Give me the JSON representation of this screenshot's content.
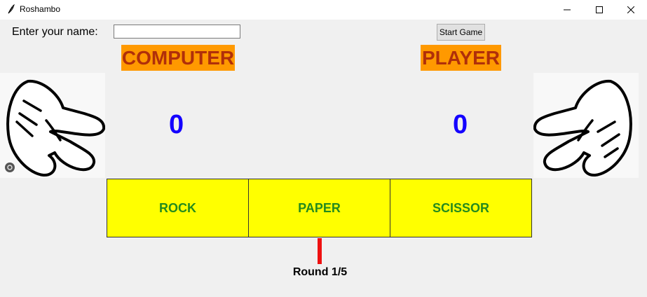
{
  "window": {
    "title": "Roshambo"
  },
  "form": {
    "name_label": "Enter your name:",
    "name_value": "",
    "name_placeholder": "",
    "start_label": "Start Game"
  },
  "computer": {
    "label": "COMPUTER",
    "score": "0",
    "hand_icon": "scissors-hand-icon"
  },
  "player": {
    "label": "PLAYER",
    "score": "0",
    "hand_icon": "scissors-hand-icon"
  },
  "choices": {
    "rock": "ROCK",
    "paper": "PAPER",
    "scissor": "SCISSOR"
  },
  "round": {
    "text": "Round 1/5",
    "current": 1,
    "total": 5
  },
  "colors": {
    "header_bg": "#ff9900",
    "header_text": "#b02f0a",
    "score": "#1400ff",
    "button_bg": "#ffff00",
    "button_text": "#258b1d",
    "progress": "#ee1111"
  }
}
